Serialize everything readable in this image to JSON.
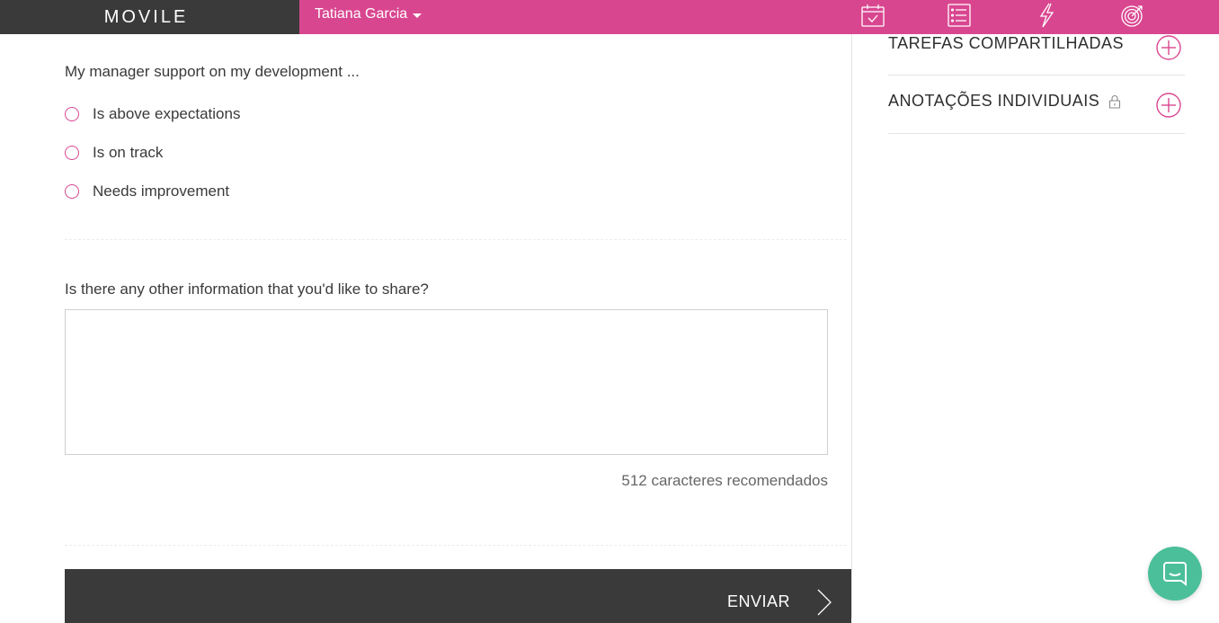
{
  "header": {
    "brand": "MOVILE",
    "user_name": "Tatiana Garcia",
    "nav_icons": [
      "calendar-check-icon",
      "checklist-icon",
      "lightning-icon",
      "target-icon"
    ]
  },
  "form": {
    "question1": "My manager support on my development ...",
    "options": [
      {
        "label": "Is above expectations",
        "selected": false
      },
      {
        "label": "Is on track",
        "selected": false
      },
      {
        "label": "Needs improvement",
        "selected": false
      }
    ],
    "question2": "Is there any other information that you'd like to share?",
    "textarea_value": "",
    "char_hint": "512 caracteres recomendados",
    "submit_label": "ENVIAR"
  },
  "sidebar": {
    "sections": [
      {
        "title": "TAREFAS COMPARTILHADAS",
        "locked": false
      },
      {
        "title": "ANOTAÇÕES INDIVIDUAIS",
        "locked": true
      }
    ]
  },
  "colors": {
    "accent": "#d94690",
    "dark": "#3a3a3a",
    "chat": "#4bbf99"
  }
}
